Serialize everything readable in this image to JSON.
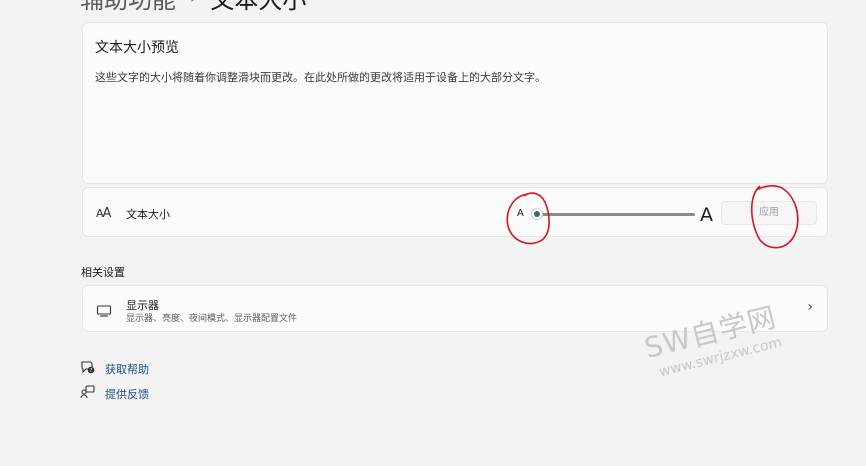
{
  "breadcrumb": {
    "parent": "辅助功能",
    "separator": "›",
    "current": "文本大小"
  },
  "preview": {
    "title": "文本大小预览",
    "text": "这些文字的大小将随着你调整滑块而更改。在此处所做的更改将适用于设备上的大部分文字。"
  },
  "text_size": {
    "icon": "text-size-icon",
    "icon_text_small": "A",
    "icon_text_big": "A",
    "label": "文本大小",
    "slider_min_label": "A",
    "slider_max_label": "A",
    "slider_value_percent": 0,
    "apply_label": "应用"
  },
  "related": {
    "heading": "相关设置",
    "display": {
      "icon": "monitor-icon",
      "title": "显示器",
      "subtitle": "显示器、亮度、夜间模式、显示器配置文件"
    }
  },
  "links": {
    "help": {
      "icon": "help-icon",
      "label": "获取帮助"
    },
    "feedback": {
      "icon": "feedback-icon",
      "label": "提供反馈"
    }
  },
  "watermark": {
    "main": "SW自学网",
    "sub": "www.swrjzxw.com"
  },
  "colors": {
    "accent": "#2b6f70",
    "annotation": "#d8141c",
    "link": "#1a4f8b"
  }
}
